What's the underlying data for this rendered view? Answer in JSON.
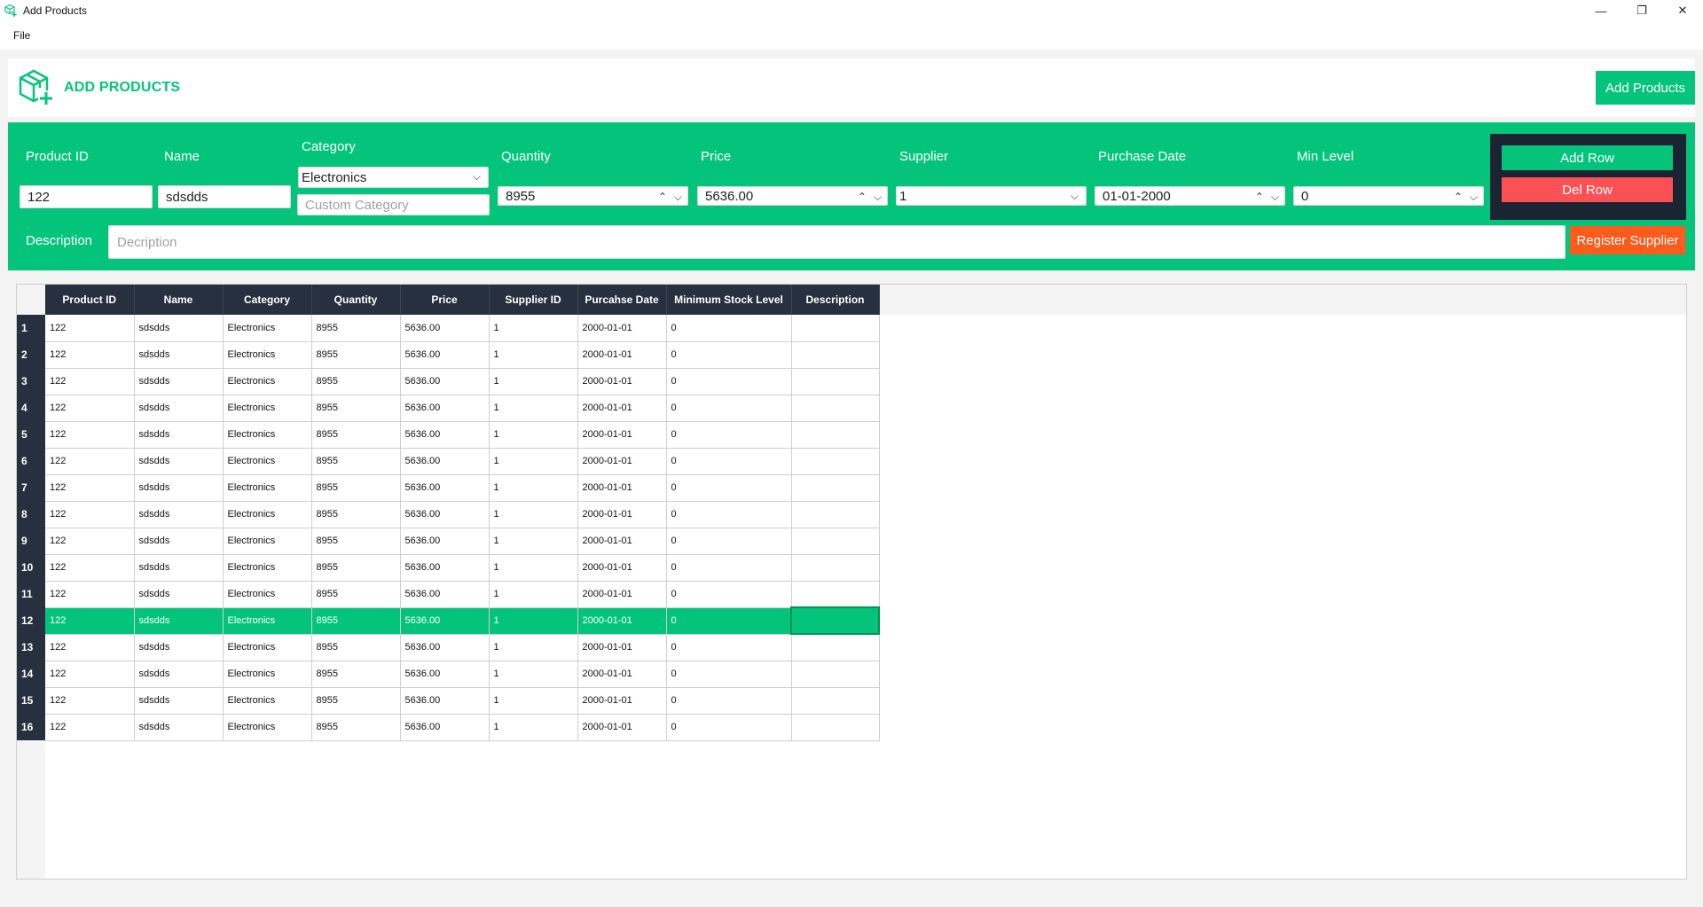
{
  "window": {
    "title": "Add Products",
    "minimize_glyph": "—",
    "restore_glyph": "❐",
    "close_glyph": "✕"
  },
  "menu": {
    "file": "File"
  },
  "header": {
    "heading": "ADD PRODUCTS",
    "add_products_button": "Add Products",
    "logo_icon": "package-add-icon",
    "accent_color": "#04c47b"
  },
  "form": {
    "product_id": {
      "label": "Product ID",
      "value": "122"
    },
    "name": {
      "label": "Name",
      "value": "sdsdds"
    },
    "category": {
      "label": "Category",
      "value": "Electronics",
      "custom_placeholder": "Custom Category"
    },
    "quantity": {
      "label": "Quantity",
      "value": "8955"
    },
    "price": {
      "label": "Price",
      "value": "5636.00"
    },
    "supplier": {
      "label": "Supplier",
      "value": "1"
    },
    "purchase_date": {
      "label": "Purchase Date",
      "value": "01-01-2000"
    },
    "min_level": {
      "label": "Min Level",
      "value": "0"
    },
    "description": {
      "label": "Description",
      "placeholder": "Decription"
    },
    "add_row_button": "Add Row",
    "del_row_button": "Del Row",
    "register_supplier_button": "Register Supplier"
  },
  "table": {
    "columns": [
      "Product ID",
      "Name",
      "Category",
      "Quantity",
      "Price",
      "Supplier ID",
      "Purcahse Date",
      "Minimum Stock Level",
      "Description"
    ],
    "selected_row": 12,
    "rows": [
      {
        "num": "1",
        "cells": [
          "122",
          "sdsdds",
          "Electronics",
          "8955",
          "5636.00",
          "1",
          "2000-01-01",
          "0",
          ""
        ]
      },
      {
        "num": "2",
        "cells": [
          "122",
          "sdsdds",
          "Electronics",
          "8955",
          "5636.00",
          "1",
          "2000-01-01",
          "0",
          ""
        ]
      },
      {
        "num": "3",
        "cells": [
          "122",
          "sdsdds",
          "Electronics",
          "8955",
          "5636.00",
          "1",
          "2000-01-01",
          "0",
          ""
        ]
      },
      {
        "num": "4",
        "cells": [
          "122",
          "sdsdds",
          "Electronics",
          "8955",
          "5636.00",
          "1",
          "2000-01-01",
          "0",
          ""
        ]
      },
      {
        "num": "5",
        "cells": [
          "122",
          "sdsdds",
          "Electronics",
          "8955",
          "5636.00",
          "1",
          "2000-01-01",
          "0",
          ""
        ]
      },
      {
        "num": "6",
        "cells": [
          "122",
          "sdsdds",
          "Electronics",
          "8955",
          "5636.00",
          "1",
          "2000-01-01",
          "0",
          ""
        ]
      },
      {
        "num": "7",
        "cells": [
          "122",
          "sdsdds",
          "Electronics",
          "8955",
          "5636.00",
          "1",
          "2000-01-01",
          "0",
          ""
        ]
      },
      {
        "num": "8",
        "cells": [
          "122",
          "sdsdds",
          "Electronics",
          "8955",
          "5636.00",
          "1",
          "2000-01-01",
          "0",
          ""
        ]
      },
      {
        "num": "9",
        "cells": [
          "122",
          "sdsdds",
          "Electronics",
          "8955",
          "5636.00",
          "1",
          "2000-01-01",
          "0",
          ""
        ]
      },
      {
        "num": "10",
        "cells": [
          "122",
          "sdsdds",
          "Electronics",
          "8955",
          "5636.00",
          "1",
          "2000-01-01",
          "0",
          ""
        ]
      },
      {
        "num": "11",
        "cells": [
          "122",
          "sdsdds",
          "Electronics",
          "8955",
          "5636.00",
          "1",
          "2000-01-01",
          "0",
          ""
        ]
      },
      {
        "num": "12",
        "cells": [
          "122",
          "sdsdds",
          "Electronics",
          "8955",
          "5636.00",
          "1",
          "2000-01-01",
          "0",
          ""
        ]
      },
      {
        "num": "13",
        "cells": [
          "122",
          "sdsdds",
          "Electronics",
          "8955",
          "5636.00",
          "1",
          "2000-01-01",
          "0",
          ""
        ]
      },
      {
        "num": "14",
        "cells": [
          "122",
          "sdsdds",
          "Electronics",
          "8955",
          "5636.00",
          "1",
          "2000-01-01",
          "0",
          ""
        ]
      },
      {
        "num": "15",
        "cells": [
          "122",
          "sdsdds",
          "Electronics",
          "8955",
          "5636.00",
          "1",
          "2000-01-01",
          "0",
          ""
        ]
      },
      {
        "num": "16",
        "cells": [
          "122",
          "sdsdds",
          "Electronics",
          "8955",
          "5636.00",
          "1",
          "2000-01-01",
          "0",
          ""
        ]
      }
    ]
  }
}
